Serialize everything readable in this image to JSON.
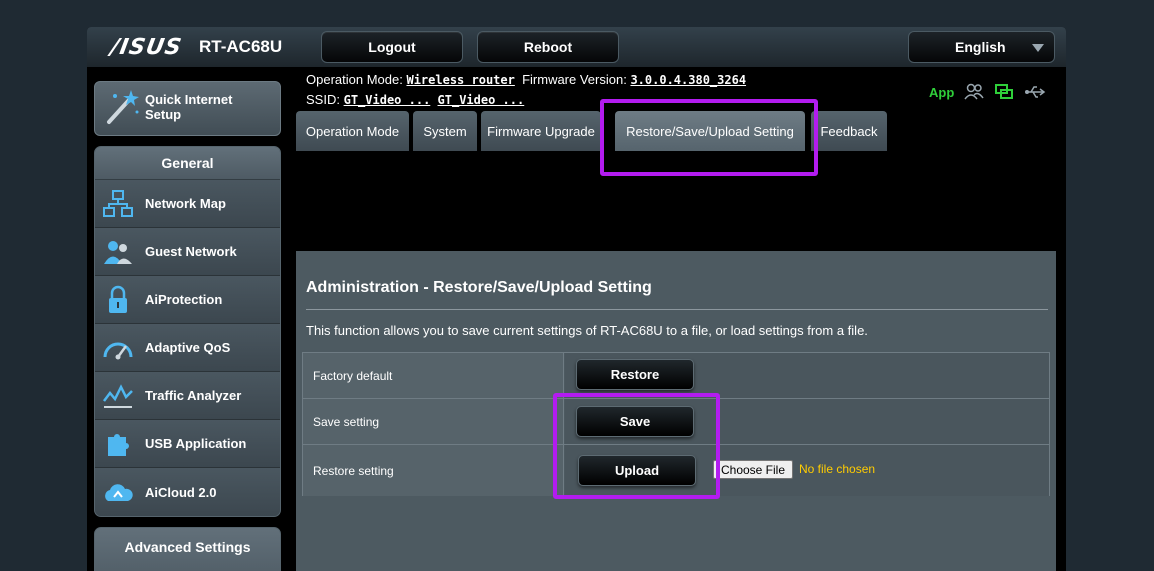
{
  "header": {
    "brand": "/ISUS",
    "model": "RT-AC68U",
    "logout_label": "Logout",
    "reboot_label": "Reboot",
    "language": "English"
  },
  "info": {
    "op_mode_label": "Operation Mode:",
    "op_mode_value": "Wireless router",
    "fw_label": "Firmware Version:",
    "fw_value": "3.0.0.4.380_3264",
    "ssid_label": "SSID:",
    "ssid_1": "GT_Video ...",
    "ssid_2": "GT_Video ...",
    "app_label": "App"
  },
  "sidebar": {
    "qis_label_line1": "Quick Internet",
    "qis_label_line2": "Setup",
    "general_title": "General",
    "items": [
      {
        "label": "Network Map"
      },
      {
        "label": "Guest Network"
      },
      {
        "label": "AiProtection"
      },
      {
        "label": "Adaptive QoS"
      },
      {
        "label": "Traffic Analyzer"
      },
      {
        "label": "USB Application"
      },
      {
        "label": "AiCloud 2.0"
      }
    ],
    "advanced_title": "Advanced Settings"
  },
  "tabs": [
    {
      "label": "Operation Mode"
    },
    {
      "label": "System"
    },
    {
      "label": "Firmware Upgrade"
    },
    {
      "label": "Restore/Save/Upload Setting"
    },
    {
      "label": "Feedback"
    }
  ],
  "content": {
    "title": "Administration - Restore/Save/Upload Setting",
    "description": "This function allows you to save current settings of RT-AC68U to a file, or load settings from a file.",
    "rows": [
      {
        "label": "Factory default",
        "button": "Restore"
      },
      {
        "label": "Save setting",
        "button": "Save"
      },
      {
        "label": "Restore setting",
        "button": "Upload"
      }
    ],
    "choose_file": "Choose File",
    "no_file": "No file chosen"
  },
  "colors": {
    "highlight": "#b31cf0",
    "app_green": "#2fcf3a",
    "no_file_yellow": "#ffcc00"
  }
}
